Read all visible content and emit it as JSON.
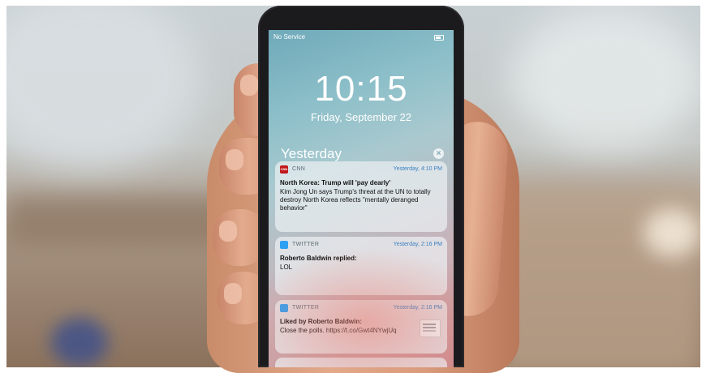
{
  "status_bar": {
    "carrier": "No Service"
  },
  "lock_screen": {
    "time": "10:15",
    "date": "Friday, September 22",
    "section_header": "Yesterday",
    "clear_icon": "x-circle-icon"
  },
  "notifications": [
    {
      "app": "CNN",
      "app_icon_text": "CNN",
      "time": "Yesterday, 4:10 PM",
      "title": "North Korea: Trump will 'pay dearly'",
      "body": "Kim Jong Un says Trump's threat at the UN to totally destroy North Korea reflects \"mentally deranged behavior\""
    },
    {
      "app": "TWITTER",
      "time": "Yesterday, 2:16 PM",
      "title": "Roberto Baldwin replied:",
      "body": "LOL"
    },
    {
      "app": "TWITTER",
      "time": "Yesterday, 2:16 PM",
      "title": "Liked by Roberto Baldwin:",
      "body": "Close the polls. https://t.co/Gwt4NYwjUq"
    }
  ],
  "colors": {
    "cnn_red": "#c0181b",
    "twitter_blue": "#2fa1f2",
    "time_blue": "#3a7fc1"
  }
}
